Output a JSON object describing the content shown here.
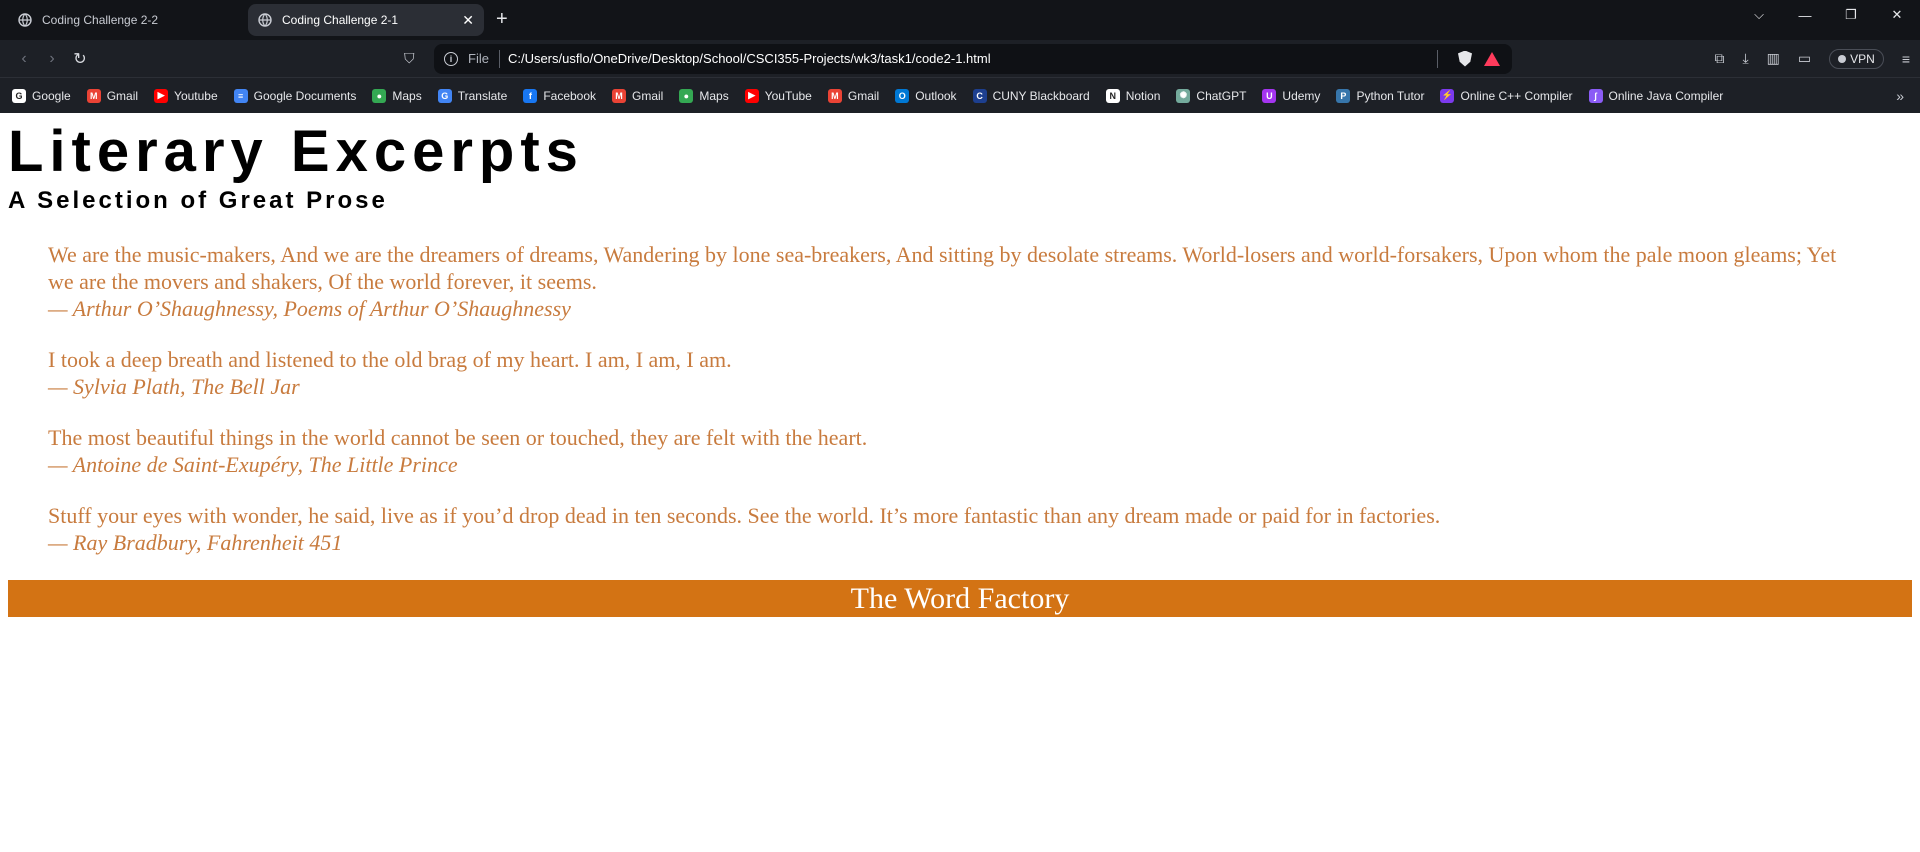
{
  "browser": {
    "tabs": [
      {
        "title": "Coding Challenge 2-2",
        "active": false
      },
      {
        "title": "Coding Challenge 2-1",
        "active": true
      }
    ],
    "new_tab_symbol": "+",
    "address": {
      "scheme_label": "File",
      "url": "C:/Users/usflo/OneDrive/Desktop/School/CSCI355-Projects/wk3/task1/code2-1.html"
    },
    "vpn_label": "VPN",
    "bookmarks": [
      {
        "label": "Google",
        "icon": "google-icon",
        "color": "#ffffff"
      },
      {
        "label": "Gmail",
        "icon": "gmail-icon",
        "color": "#ea4335"
      },
      {
        "label": "Youtube",
        "icon": "youtube-icon",
        "color": "#ff0000"
      },
      {
        "label": "Google Documents",
        "icon": "docs-icon",
        "color": "#4285f4"
      },
      {
        "label": "Maps",
        "icon": "maps-icon",
        "color": "#34a853"
      },
      {
        "label": "Translate",
        "icon": "translate-icon",
        "color": "#4285f4"
      },
      {
        "label": "Facebook",
        "icon": "facebook-icon",
        "color": "#1877f2"
      },
      {
        "label": "Gmail",
        "icon": "gmail-icon",
        "color": "#ea4335"
      },
      {
        "label": "Maps",
        "icon": "maps-icon",
        "color": "#34a853"
      },
      {
        "label": "YouTube",
        "icon": "youtube-icon",
        "color": "#ff0000"
      },
      {
        "label": "Gmail",
        "icon": "gmail-icon",
        "color": "#ea4335"
      },
      {
        "label": "Outlook",
        "icon": "outlook-icon",
        "color": "#0078d4"
      },
      {
        "label": "CUNY Blackboard",
        "icon": "cuny-icon",
        "color": "#1d3f8f"
      },
      {
        "label": "Notion",
        "icon": "notion-icon",
        "color": "#ffffff"
      },
      {
        "label": "ChatGPT",
        "icon": "chatgpt-icon",
        "color": "#74aa9c"
      },
      {
        "label": "Udemy",
        "icon": "udemy-icon",
        "color": "#a435f0"
      },
      {
        "label": "Python Tutor",
        "icon": "python-icon",
        "color": "#3776ab"
      },
      {
        "label": "Online C++ Compiler",
        "icon": "cpp-compiler-icon",
        "color": "#7c3aed"
      },
      {
        "label": "Online Java Compiler",
        "icon": "java-compiler-icon",
        "color": "#8b5cf6"
      }
    ]
  },
  "page": {
    "title": "Literary Excerpts",
    "subtitle": "A Selection of Great Prose",
    "quotes": [
      {
        "text": "We are the music-makers, And we are the dreamers of dreams, Wandering by lone sea-breakers, And sitting by desolate streams. World-losers and world-forsakers, Upon whom the pale moon gleams; Yet we are the movers and shakers, Of the world forever, it seems.",
        "attribution": "— Arthur O’Shaughnessy, Poems of Arthur O’Shaughnessy"
      },
      {
        "text": "I took a deep breath and listened to the old brag of my heart. I am, I am, I am.",
        "attribution": "— Sylvia Plath, The Bell Jar"
      },
      {
        "text": "The most beautiful things in the world cannot be seen or touched, they are felt with the heart.",
        "attribution": "— Antoine de Saint-Exupéry, The Little Prince"
      },
      {
        "text": "Stuff your eyes with wonder, he said, live as if you’d drop dead in ten seconds. See the world. It’s more fantastic than any dream made or paid for in factories.",
        "attribution": "— Ray Bradbury, Fahrenheit 451"
      }
    ],
    "footer": "The Word Factory",
    "colors": {
      "quote": "#c87b3e",
      "footer_bg": "#d37314"
    }
  }
}
